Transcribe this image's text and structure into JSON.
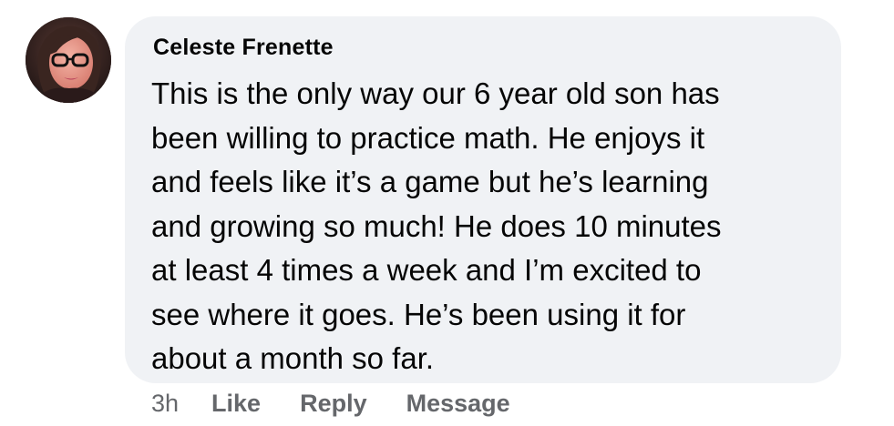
{
  "comment": {
    "author": "Celeste Frenette",
    "text_lines": [
      "This is the only way our 6 year old son has",
      "been willing to practice math. He enjoys it",
      "and feels like it’s a game but he’s learning",
      "and growing so much! He does 10 minutes",
      "at least 4 times a week and I’m excited to",
      "see where it goes. He’s been using it for",
      "about a month so far."
    ],
    "timestamp": "3h",
    "actions": {
      "like": "Like",
      "reply": "Reply",
      "message": "Message"
    }
  },
  "colors": {
    "bubble_background": "#f0f2f5",
    "text_primary": "#050505",
    "text_secondary": "#65676b"
  },
  "avatar": {
    "icon": "profile-photo-avatar"
  }
}
